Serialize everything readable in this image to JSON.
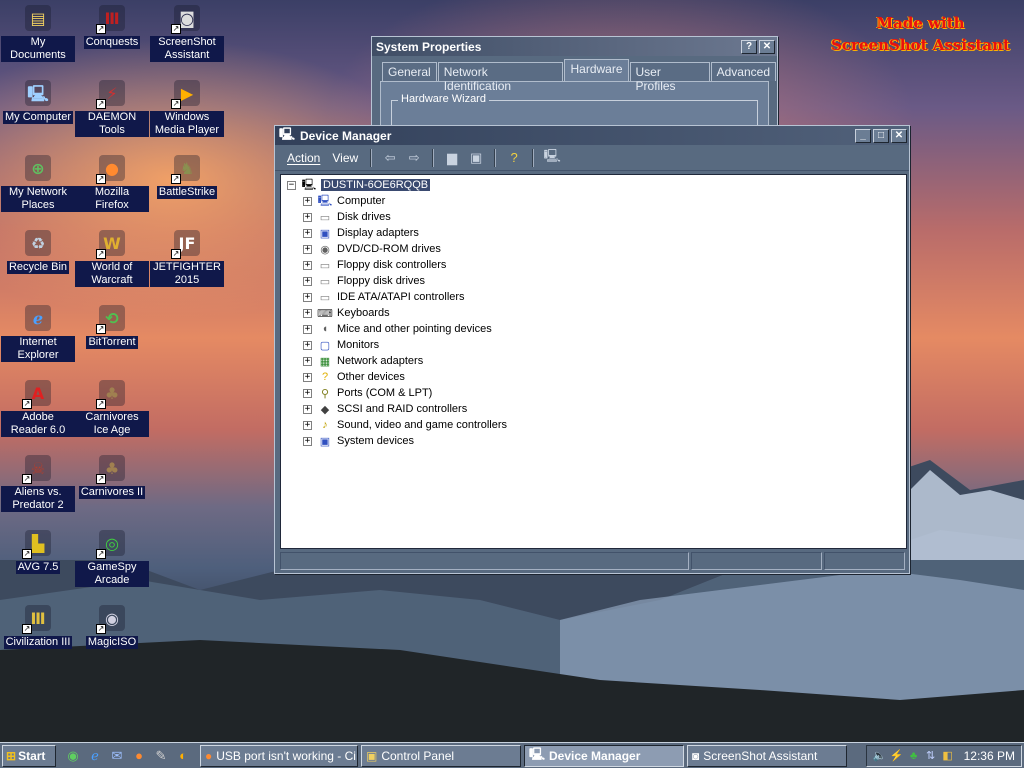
{
  "watermark": {
    "line1": "Made with",
    "line2": "ScreenShot Assistant"
  },
  "desktop_icons": [
    {
      "label": "My Documents",
      "icon": "my-documents-icon"
    },
    {
      "label": "Conquests",
      "icon": "conquests-icon"
    },
    {
      "label": "ScreenShot Assistant",
      "icon": "camera-icon"
    },
    {
      "label": "My Computer",
      "icon": "my-computer-icon"
    },
    {
      "label": "DAEMON Tools",
      "icon": "daemon-tools-icon"
    },
    {
      "label": "Windows Media Player",
      "icon": "media-player-icon"
    },
    {
      "label": "My Network Places",
      "icon": "network-places-icon"
    },
    {
      "label": "Mozilla Firefox",
      "icon": "firefox-icon"
    },
    {
      "label": "BattleStrike",
      "icon": "battlestrike-icon"
    },
    {
      "label": "Recycle Bin",
      "icon": "recycle-bin-icon"
    },
    {
      "label": "World of Warcraft",
      "icon": "warcraft-icon"
    },
    {
      "label": "JETFIGHTER 2015",
      "icon": "jetfighter-icon"
    },
    {
      "label": "Internet Explorer",
      "icon": "internet-explorer-icon"
    },
    {
      "label": "BitTorrent",
      "icon": "bittorrent-icon"
    },
    {
      "label": "Adobe Reader 6.0",
      "icon": "adobe-reader-icon"
    },
    {
      "label": "Carnivores Ice Age",
      "icon": "carnivores-ice-age-icon"
    },
    {
      "label": "Aliens vs. Predator 2",
      "icon": "avp2-icon"
    },
    {
      "label": "Carnivores II",
      "icon": "carnivores-2-icon"
    },
    {
      "label": "AVG 7.5",
      "icon": "avg-icon"
    },
    {
      "label": "GameSpy Arcade",
      "icon": "gamespy-icon"
    },
    {
      "label": "Civilization III",
      "icon": "civilization-icon"
    },
    {
      "label": "MagicISO",
      "icon": "magiciso-icon"
    }
  ],
  "system_properties": {
    "title": "System Properties",
    "help_btn": "?",
    "close_btn": "✕",
    "tabs": [
      "General",
      "Network Identification",
      "Hardware",
      "User Profiles",
      "Advanced"
    ],
    "active_tab": "Hardware",
    "group_label": "Hardware Wizard"
  },
  "device_manager": {
    "title": "Device Manager",
    "menu": {
      "action": "Action",
      "view": "View"
    },
    "root": "DUSTIN-6OE6RQQB",
    "root_toggle": "−",
    "node_toggle": "+",
    "nodes": [
      {
        "label": "Computer",
        "icon": "computer-icon"
      },
      {
        "label": "Disk drives",
        "icon": "disk-drive-icon"
      },
      {
        "label": "Display adapters",
        "icon": "display-adapter-icon"
      },
      {
        "label": "DVD/CD-ROM drives",
        "icon": "dvd-drive-icon"
      },
      {
        "label": "Floppy disk controllers",
        "icon": "floppy-controller-icon"
      },
      {
        "label": "Floppy disk drives",
        "icon": "floppy-drive-icon"
      },
      {
        "label": "IDE ATA/ATAPI controllers",
        "icon": "ide-controller-icon"
      },
      {
        "label": "Keyboards",
        "icon": "keyboard-icon"
      },
      {
        "label": "Mice and other pointing devices",
        "icon": "mouse-icon"
      },
      {
        "label": "Monitors",
        "icon": "monitor-icon"
      },
      {
        "label": "Network adapters",
        "icon": "network-adapter-icon"
      },
      {
        "label": "Other devices",
        "icon": "question-icon"
      },
      {
        "label": "Ports (COM & LPT)",
        "icon": "port-icon"
      },
      {
        "label": "SCSI and RAID controllers",
        "icon": "scsi-icon"
      },
      {
        "label": "Sound, video and game controllers",
        "icon": "sound-icon"
      },
      {
        "label": "System devices",
        "icon": "system-device-icon"
      }
    ]
  },
  "taskbar": {
    "start": "Start",
    "tasks": [
      {
        "label": "USB port isn't working - Ci...",
        "icon": "firefox-icon",
        "active": false
      },
      {
        "label": "Control Panel",
        "icon": "folder-icon",
        "active": false
      },
      {
        "label": "Device Manager",
        "icon": "device-manager-icon",
        "active": true
      },
      {
        "label": "ScreenShot Assistant",
        "icon": "camera-icon",
        "active": false
      }
    ],
    "clock": "12:36 PM"
  }
}
